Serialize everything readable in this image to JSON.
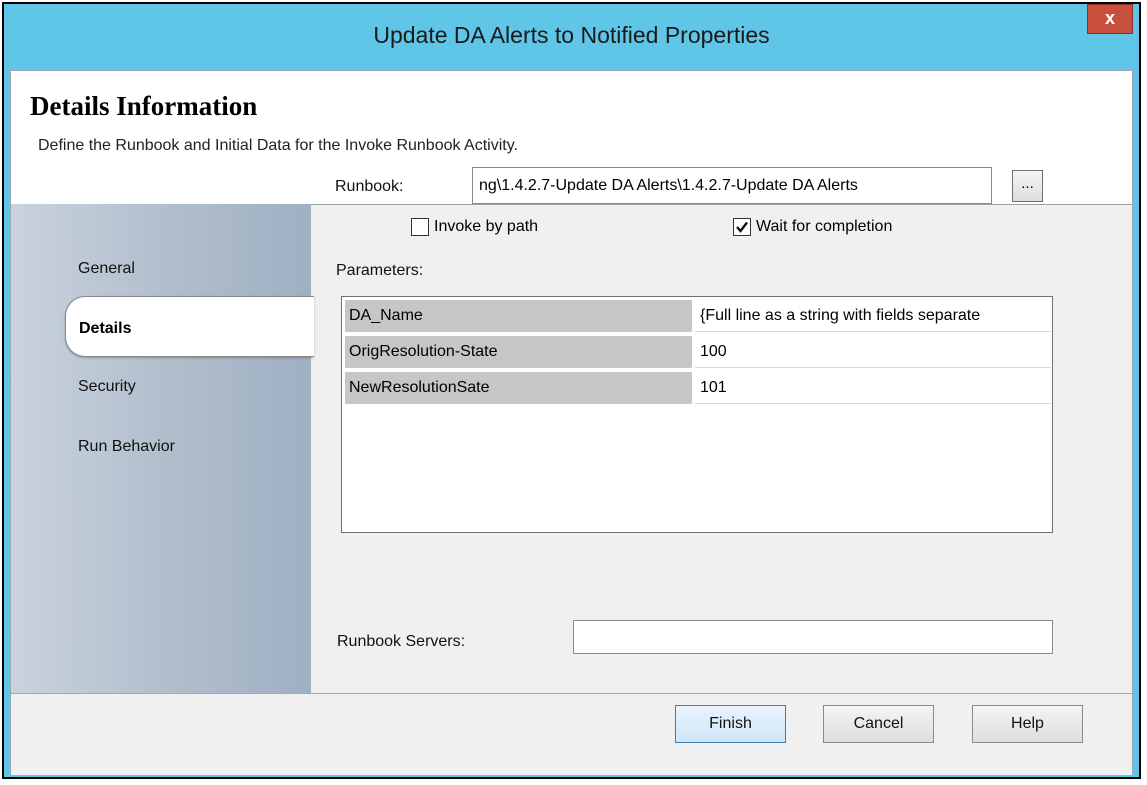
{
  "window": {
    "title": "Update DA Alerts to Notified Properties",
    "close_label": "x"
  },
  "header": {
    "title": "Details Information",
    "subtitle": "Define the Runbook and Initial Data for the Invoke Runbook Activity."
  },
  "nav": {
    "items": [
      {
        "label": "General",
        "selected": false
      },
      {
        "label": "Details",
        "selected": true
      },
      {
        "label": "Security",
        "selected": false
      },
      {
        "label": "Run Behavior",
        "selected": false
      }
    ]
  },
  "form": {
    "runbook_label": "Runbook:",
    "runbook_value": "ng\\1.4.2.7-Update DA Alerts\\1.4.2.7-Update DA Alerts",
    "browse_label": "...",
    "invoke_by_path_label": "Invoke by path",
    "invoke_by_path_checked": false,
    "wait_for_completion_label": "Wait for completion",
    "wait_for_completion_checked": true,
    "parameters_label": "Parameters:",
    "parameters": [
      {
        "name": "DA_Name",
        "value": "{Full line as a string with fields separate"
      },
      {
        "name": "OrigResolution-State",
        "value": "100"
      },
      {
        "name": "NewResolutionSate",
        "value": "101"
      }
    ],
    "runbook_servers_label": "Runbook Servers:",
    "runbook_servers_value": ""
  },
  "buttons": {
    "finish": "Finish",
    "cancel": "Cancel",
    "help": "Help"
  }
}
